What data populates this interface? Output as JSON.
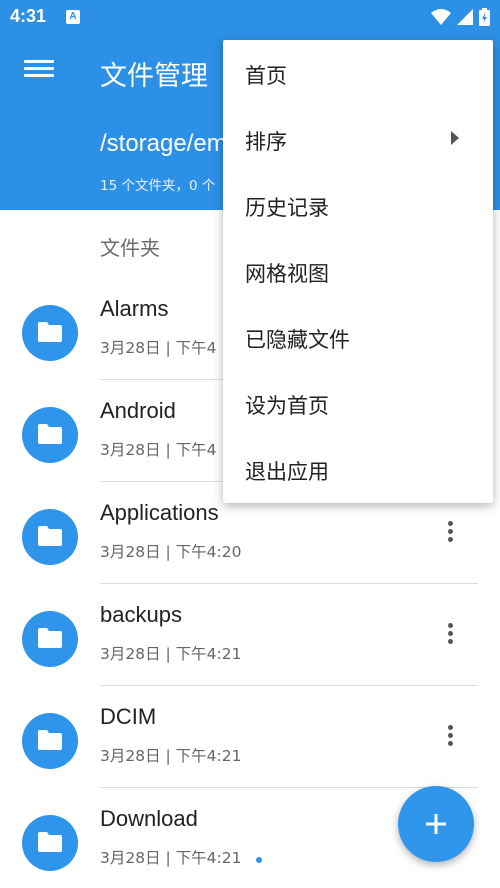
{
  "status_bar": {
    "time": "4:31",
    "notification_glyph": "A"
  },
  "app_bar": {
    "title": "文件管理",
    "path": "/storage/em",
    "summary": "15 个文件夹，0 个"
  },
  "section_header": "文件夹",
  "folders": [
    {
      "name": "Alarms",
      "meta": "3月28日 | 下午4"
    },
    {
      "name": "Android",
      "meta": "3月28日 | 下午4"
    },
    {
      "name": "Applications",
      "meta": "3月28日 | 下午4:20"
    },
    {
      "name": "backups",
      "meta": "3月28日 | 下午4:21"
    },
    {
      "name": "DCIM",
      "meta": "3月28日 | 下午4:21"
    },
    {
      "name": "Download",
      "meta": "3月28日 | 下午4:21"
    }
  ],
  "popup_menu": [
    {
      "label": "首页"
    },
    {
      "label": "排序"
    },
    {
      "label": "历史记录"
    },
    {
      "label": "网格视图"
    },
    {
      "label": "已隐藏文件"
    },
    {
      "label": "设为首页"
    },
    {
      "label": "退出应用"
    }
  ],
  "icons": {
    "menu": "hamburger-icon",
    "folder": "folder-icon",
    "more": "more-vert-icon",
    "submenu": "arrow-right-icon",
    "fab": "plus-icon",
    "wifi": "wifi-icon",
    "signal": "signal-icon",
    "battery": "battery-icon"
  },
  "colors": {
    "primary": "#2b90e6",
    "accent": "#2f95ea"
  }
}
